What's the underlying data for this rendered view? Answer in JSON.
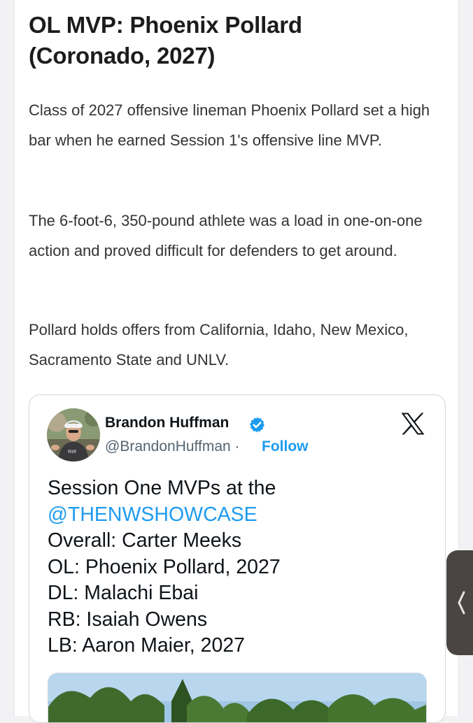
{
  "article": {
    "headline_line1": "OL MVP: Phoenix Pollard",
    "headline_line2": "(Coronado, 2027)",
    "paragraphs": [
      "Class of 2027 offensive lineman Phoenix Pollard set a high bar when he earned Session 1's offensive line MVP.",
      "The 6-foot-6, 350-pound athlete was a load in one-on-one action and proved difficult for defenders to get around.",
      "Pollard holds offers from California, Idaho, New Mexico, Sacramento State and UNLV."
    ]
  },
  "tweet": {
    "author_name": "Brandon Huffman",
    "handle": "@BrandonHuffman",
    "separator": " · ",
    "follow_label": "Follow",
    "lines": [
      "Session One MVPs at the",
      "@THENWSHOWCASE",
      "Overall: Carter Meeks",
      "OL: Phoenix Pollard, 2027",
      "DL: Malachi Ebai",
      "RB: Isaiah Owens",
      "LB: Aaron Maier, 2027"
    ],
    "icons": {
      "verified": "verified-badge-icon",
      "platform": "x-logo-icon"
    },
    "colors": {
      "link": "#1d9bf0",
      "handle": "#536471"
    }
  },
  "sidebar_tab": {
    "icon": "chevron-left-icon"
  }
}
